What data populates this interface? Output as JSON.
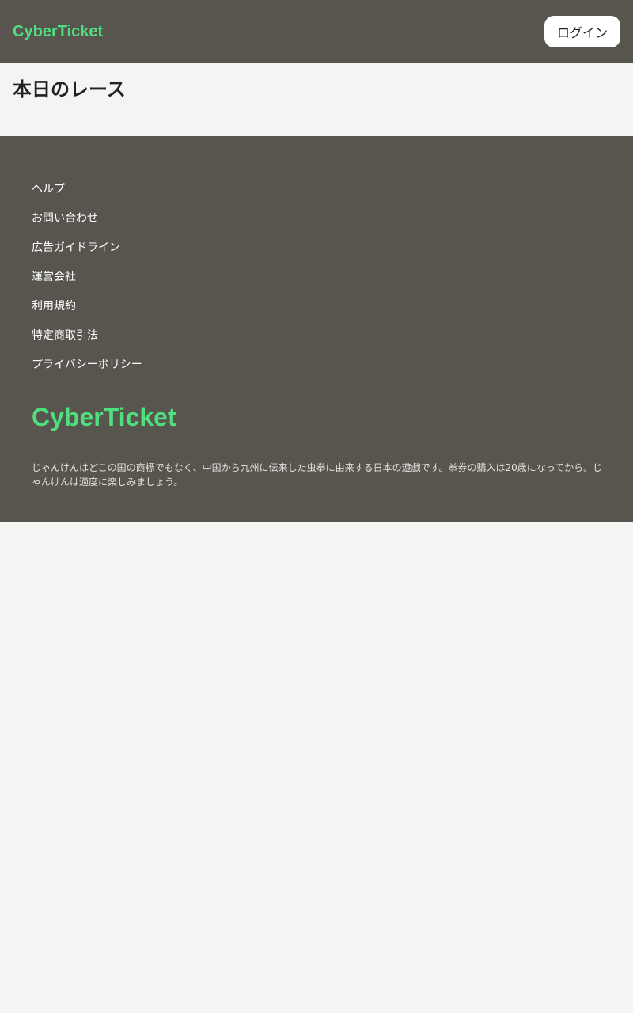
{
  "header": {
    "logo": "CyberTicket",
    "login_label": "ログイン"
  },
  "main": {
    "title": "本日のレース"
  },
  "footer": {
    "links": [
      "ヘルプ",
      "お問い合わせ",
      "広告ガイドライン",
      "運営会社",
      "利用規約",
      "特定商取引法",
      "プライバシーポリシー"
    ],
    "logo": "CyberTicket",
    "disclaimer": "じゃんけんはどこの国の商標でもなく、中国から九州に伝来した虫拳に由来する日本の遊戯です。拳券の購入は20歳になってから。じゃんけんは適度に楽しみましょう。"
  },
  "colors": {
    "header_bg": "#58554f",
    "brand_green": "#4fdf7f",
    "page_bg": "#f4f4f2"
  }
}
